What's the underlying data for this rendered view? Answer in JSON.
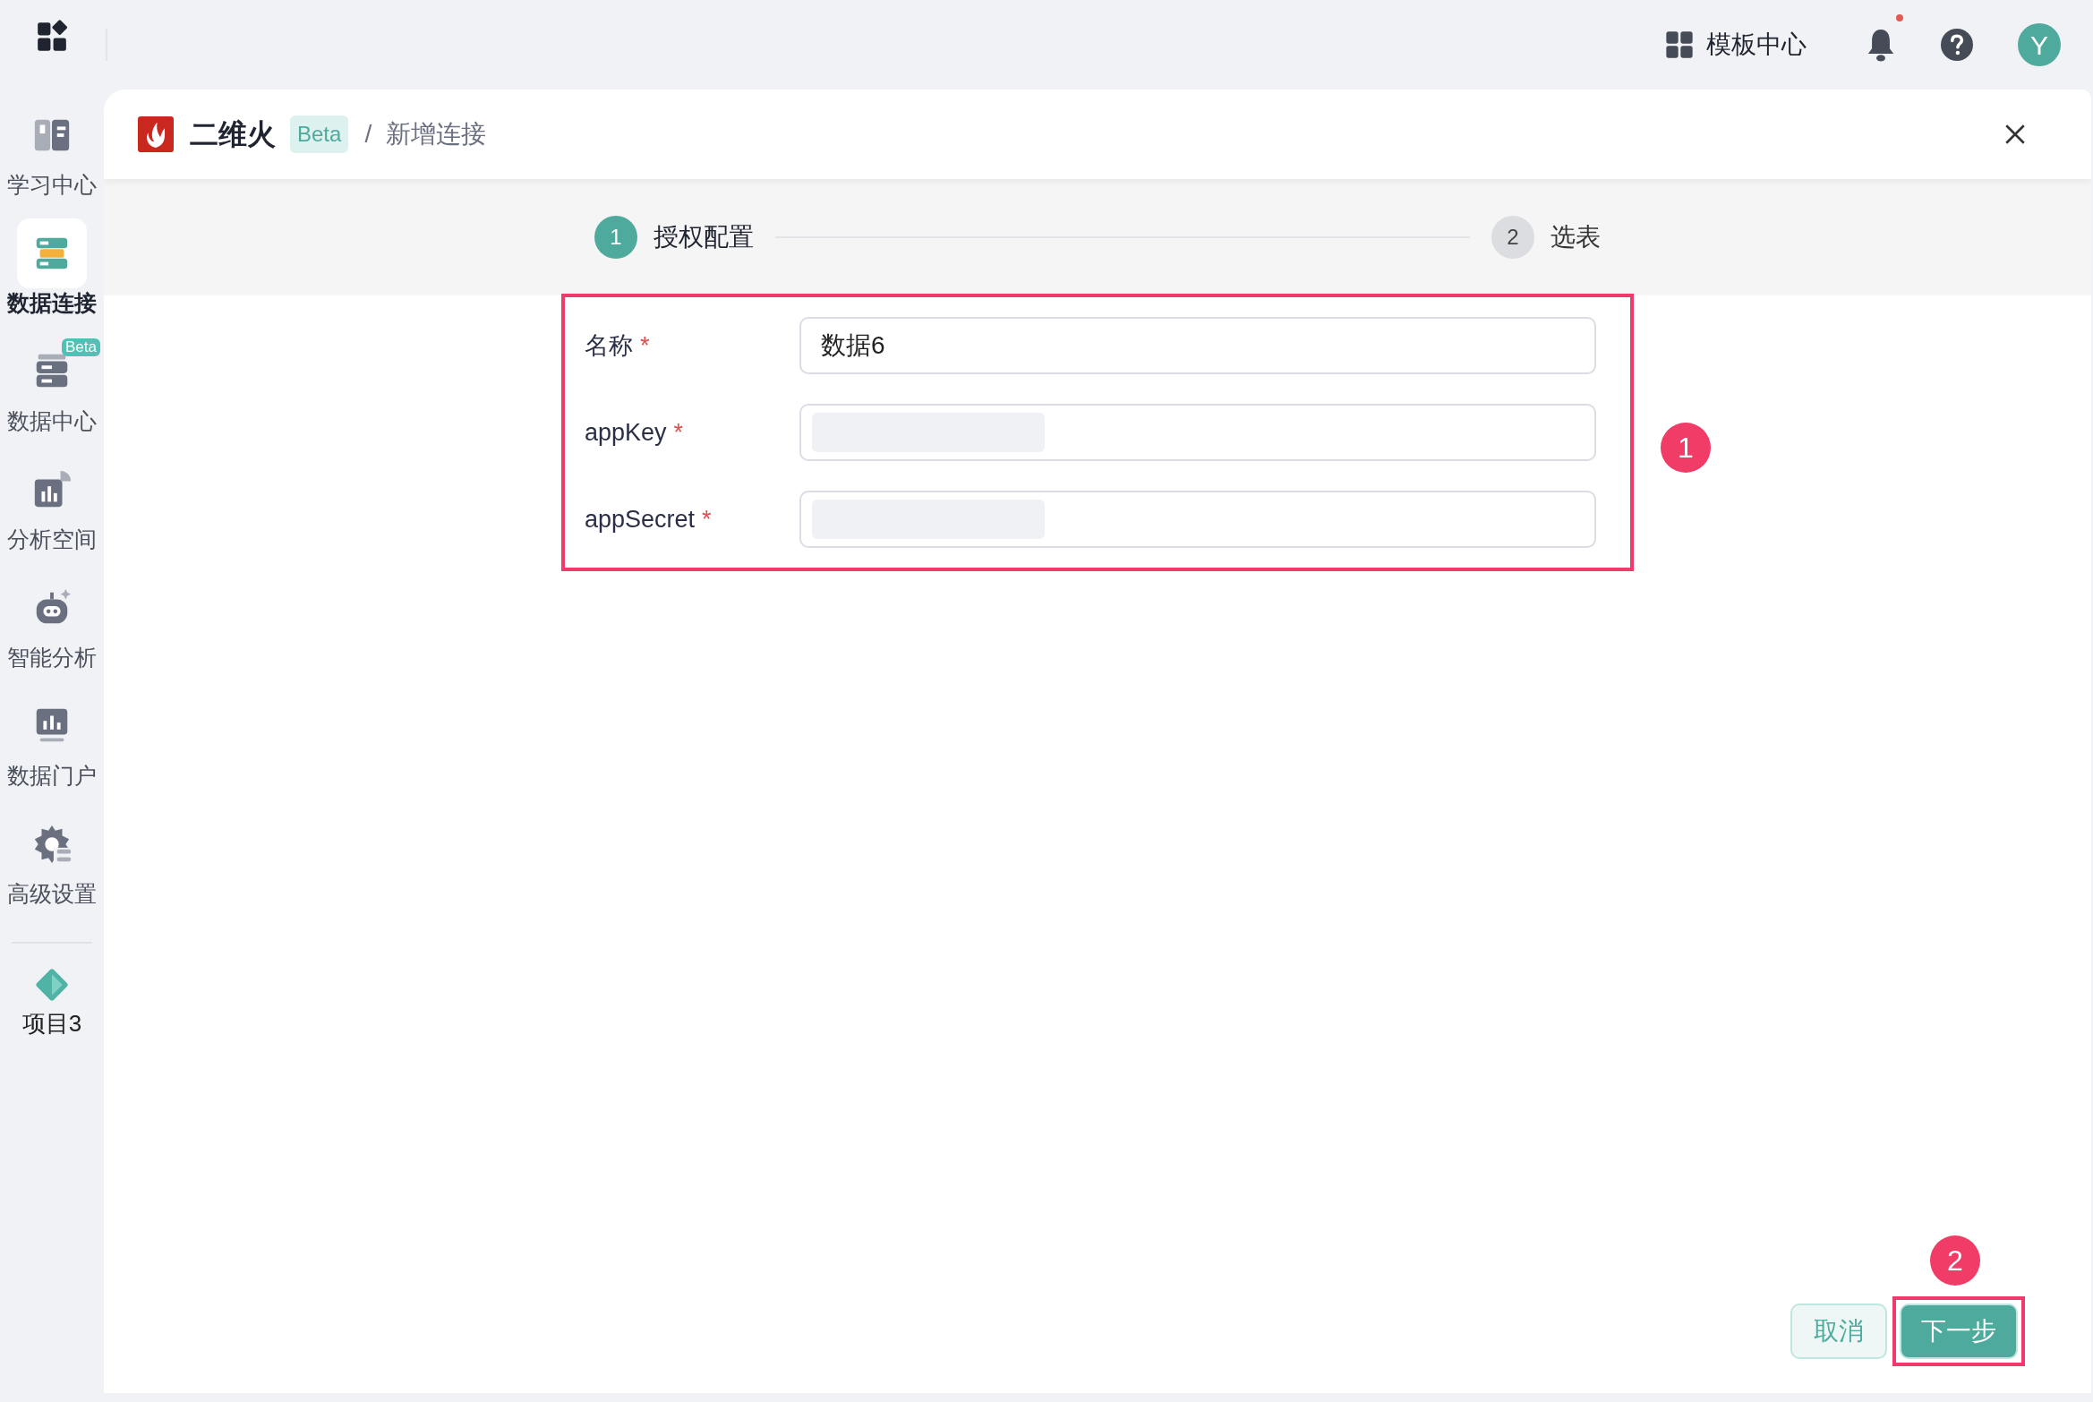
{
  "sidebar": {
    "items": [
      {
        "label": "学习中心",
        "selected": false
      },
      {
        "label": "数据连接",
        "selected": true
      },
      {
        "label": "数据中心",
        "selected": false,
        "badge": "Beta"
      },
      {
        "label": "分析空间",
        "selected": false
      },
      {
        "label": "智能分析",
        "selected": false
      },
      {
        "label": "数据门户",
        "selected": false
      },
      {
        "label": "高级设置",
        "selected": false
      }
    ],
    "project": {
      "label": "项目3"
    }
  },
  "top_bar": {
    "template_center": "模板中心",
    "notifications": {
      "unread": true
    },
    "avatar": "Y"
  },
  "header": {
    "app_name": "二维火",
    "app_badge": "Beta",
    "separator": "/",
    "breadcrumb": "新增连接"
  },
  "steps": [
    {
      "number": "1",
      "label": "授权配置",
      "selected": true
    },
    {
      "number": "2",
      "label": "选表",
      "selected": false
    }
  ],
  "form": {
    "fields": [
      {
        "label": "名称",
        "required_mark": "*",
        "value": "数据6",
        "redacted": false
      },
      {
        "label": "appKey",
        "required_mark": "*",
        "redacted": true
      },
      {
        "label": "appSecret",
        "required_mark": "*",
        "redacted": true
      }
    ]
  },
  "annotations": [
    {
      "number": "1"
    },
    {
      "number": "2"
    }
  ],
  "buttons": {
    "cancel": "取消",
    "next": "下一步"
  }
}
